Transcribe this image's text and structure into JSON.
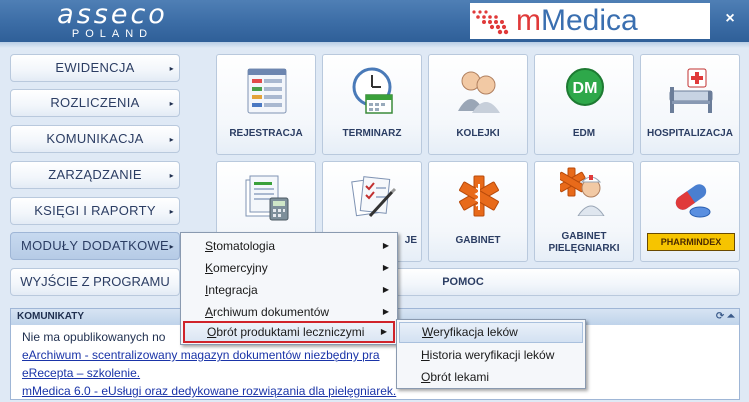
{
  "header": {
    "brand_left": "asseco",
    "brand_left_sub": "POLAND",
    "brand_right_m": "m",
    "brand_right_word": "Medica",
    "close": "×"
  },
  "menu": {
    "items": [
      "EWIDENCJA",
      "ROZLICZENIA",
      "KOMUNIKACJA",
      "ZARZĄDZANIE",
      "KSIĘGI I RAPORTY",
      "MODUŁY DODATKOWE"
    ],
    "exit": "WYJŚCIE Z PROGRAMU",
    "help": "POMOC"
  },
  "tiles": [
    {
      "label": "REJESTRACJA",
      "icon": "registration-icon"
    },
    {
      "label": "TERMINARZ",
      "icon": "calendar-clock-icon"
    },
    {
      "label": "KOLEJKI",
      "icon": "queue-people-icon"
    },
    {
      "label": "EDM",
      "icon": "edm-icon",
      "icon_text": "DM"
    },
    {
      "label": "HOSPITALIZACJA",
      "icon": "hospital-bed-icon"
    },
    {
      "label": "",
      "icon": "documents-calculator-icon"
    },
    {
      "label": "JE",
      "icon": "checklist-pen-icon"
    },
    {
      "label": "GABINET",
      "icon": "star-of-life-icon"
    },
    {
      "label_line1": "GABINET",
      "label_line2": "PIELĘGNIARKI",
      "icon": "nurse-icon"
    },
    {
      "label": "PHARMINDEX",
      "icon": "pills-icon"
    }
  ],
  "messages": {
    "title": "KOMUNIKATY",
    "items": [
      {
        "text": "Nie ma opublikowanych no",
        "link": false
      },
      {
        "text": "eArchiwum - scentralizowany magazyn dokumentów niezbędny pra",
        "link": true
      },
      {
        "text": "eRecepta – szkolenie.",
        "link": true
      },
      {
        "text": "mMedica 6.0 - eUsługi oraz dedykowane rozwiązania dla pielęgniarek.",
        "link": true
      }
    ]
  },
  "submenu": {
    "items": [
      {
        "first": "S",
        "rest": "tomatologia"
      },
      {
        "first": "K",
        "rest": "omercyjny"
      },
      {
        "first": "I",
        "rest": "ntegracja"
      },
      {
        "first": "A",
        "rest": "rchiwum dokumentów"
      },
      {
        "first": "O",
        "rest": "brót produktami leczniczymi"
      }
    ]
  },
  "submenu2": {
    "items": [
      {
        "first": "W",
        "rest": "eryfikacja leków"
      },
      {
        "first": "H",
        "rest": "istoria weryfikacji leków"
      },
      {
        "first": "O",
        "rest": "brót lekami"
      }
    ]
  },
  "colors": {
    "header": "#3d6ea7",
    "accent_red": "#d0232a",
    "link": "#1a34a8"
  }
}
